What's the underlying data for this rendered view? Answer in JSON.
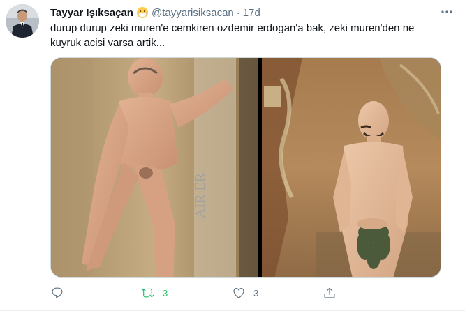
{
  "tweet": {
    "display_name": "Tayyar Işıksaçan",
    "handle": "@tayyarisiksacan",
    "separator": "·",
    "time": "17d",
    "text": "durup durup zeki muren'e cemkiren ozdemir erdogan'a bak, zeki muren'den ne kuyruk acisi varsa artik...",
    "emoji": "mask-face-emoji",
    "media": {
      "left_image": "vintage magazine photo, standing nude man, paper background with faded vertical lettering",
      "right_image": "vintage painted photo, nude man covering with leaves, ornate background"
    },
    "actions": {
      "reply_count": "",
      "retweet_count": "3",
      "like_count": "3",
      "share_count": ""
    }
  },
  "colors": {
    "text_primary": "#0f1419",
    "text_secondary": "#5b7083",
    "retweet_active": "#17bf63",
    "border": "#cfd9de"
  }
}
